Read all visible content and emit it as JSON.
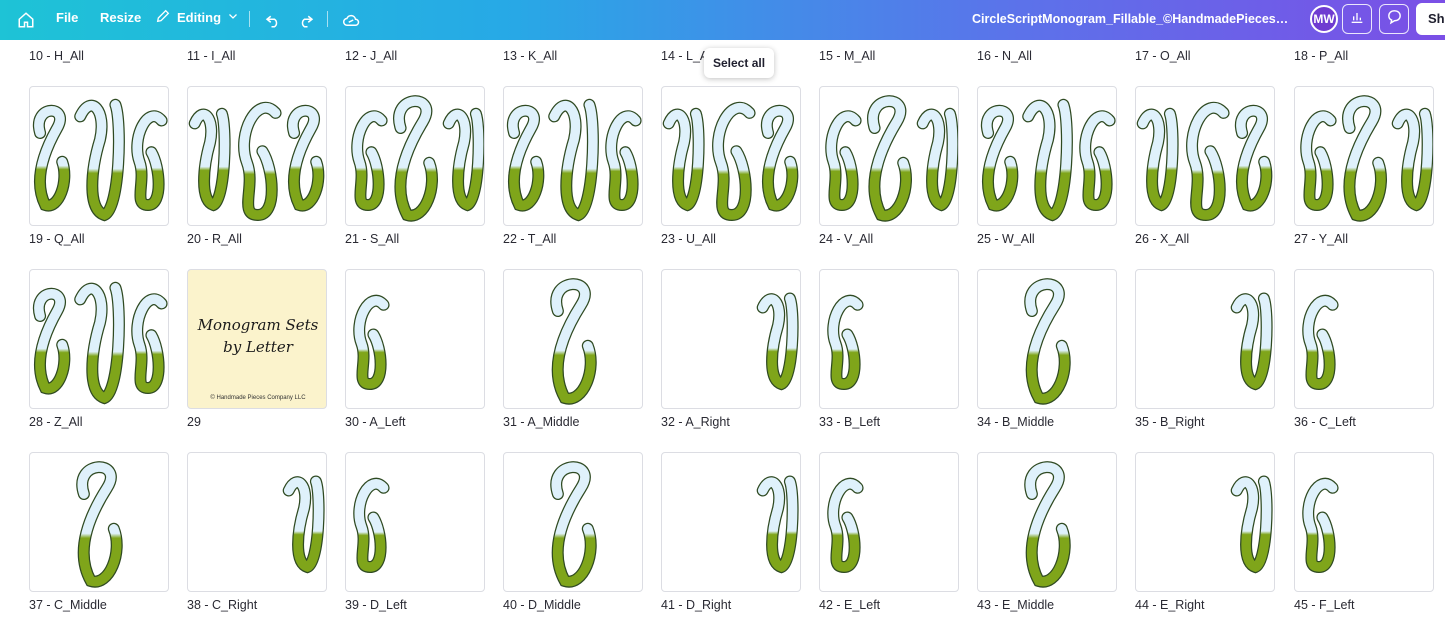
{
  "topbar": {
    "file_label": "File",
    "resize_label": "Resize",
    "editing_label": "Editing",
    "document_title": "CircleScriptMonogram_Fillable_©HandmadePiecesCompan...",
    "avatar_initials": "MW",
    "share_label": "Sha",
    "icons": [
      "home-icon",
      "pencil-icon",
      "chevron-down-icon",
      "undo-icon",
      "redo-icon",
      "cloud-icon",
      "chart-icon",
      "comment-icon"
    ],
    "gradient_colors": [
      "#1ec3d6",
      "#27a9e6",
      "#5b73ea",
      "#7b4fe6"
    ]
  },
  "tooltip": {
    "label": "Select all"
  },
  "top_row_labels": [
    "10 - H_All",
    "11 - I_All",
    "12 - J_All",
    "13 - K_All",
    "14 - L_All",
    "15 - M_All",
    "16 - N_All",
    "17 - O_All",
    "18 - P_All"
  ],
  "pages": [
    {
      "label": "19 - Q_All",
      "kind": "all"
    },
    {
      "label": "20 - R_All",
      "kind": "all"
    },
    {
      "label": "21 - S_All",
      "kind": "all"
    },
    {
      "label": "22 - T_All",
      "kind": "all"
    },
    {
      "label": "23 - U_All",
      "kind": "all"
    },
    {
      "label": "24 - V_All",
      "kind": "all"
    },
    {
      "label": "25 - W_All",
      "kind": "all"
    },
    {
      "label": "26 - X_All",
      "kind": "all"
    },
    {
      "label": "27 - Y_All",
      "kind": "all"
    },
    {
      "label": "28 - Z_All",
      "kind": "all"
    },
    {
      "label": "29",
      "kind": "cover",
      "cover_title_line1": "Monogram Sets",
      "cover_title_line2": "by Letter",
      "cover_copyright": "© Handmade Pieces Company LLC"
    },
    {
      "label": "30 - A_Left",
      "kind": "left"
    },
    {
      "label": "31 - A_Middle",
      "kind": "middle"
    },
    {
      "label": "32 - A_Right",
      "kind": "right"
    },
    {
      "label": "33 - B_Left",
      "kind": "left"
    },
    {
      "label": "34 - B_Middle",
      "kind": "middle"
    },
    {
      "label": "35 - B_Right",
      "kind": "right"
    },
    {
      "label": "36 - C_Left",
      "kind": "left"
    },
    {
      "label": "37 - C_Middle",
      "kind": "middle"
    },
    {
      "label": "38 - C_Right",
      "kind": "right"
    },
    {
      "label": "39 - D_Left",
      "kind": "left"
    },
    {
      "label": "40 - D_Middle",
      "kind": "middle"
    },
    {
      "label": "41 - D_Right",
      "kind": "right"
    },
    {
      "label": "42 - E_Left",
      "kind": "left"
    },
    {
      "label": "43 - E_Middle",
      "kind": "middle"
    },
    {
      "label": "44 - E_Right",
      "kind": "right"
    },
    {
      "label": "45 - F_Left",
      "kind": "left"
    }
  ],
  "colors": {
    "letter_fill_top": "#dff1fb",
    "letter_fill_bottom": "#7fa51a",
    "letter_stroke": "#2f4a22",
    "cover_bg": "#fbf3cc"
  }
}
